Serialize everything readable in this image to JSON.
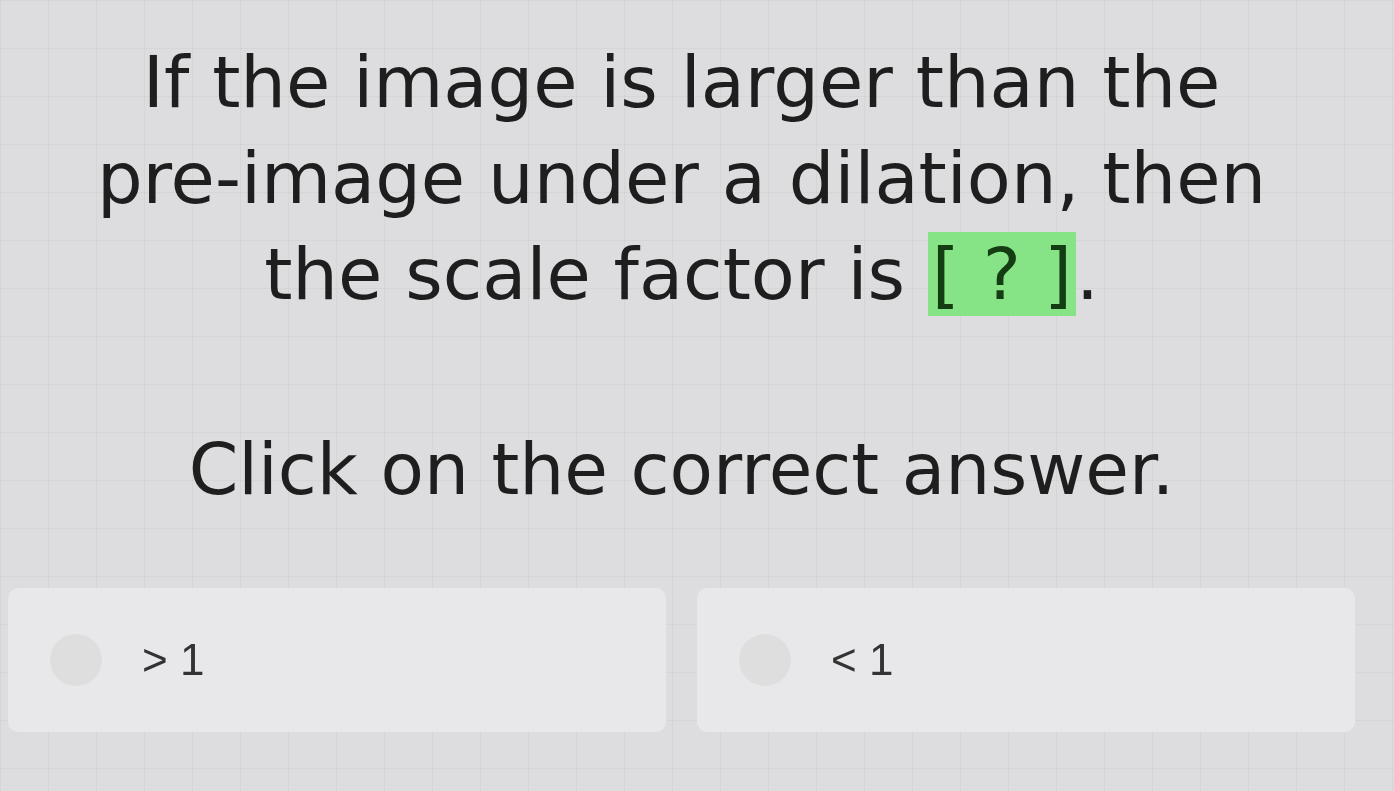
{
  "question": {
    "text": "If the image is larger than the pre-image under a dilation, then the scale factor is",
    "blank": "[ ? ]",
    "end": "."
  },
  "instruction": "Click on the correct answer.",
  "options": [
    {
      "label": "> 1",
      "selected": false
    },
    {
      "label": "< 1",
      "selected": false
    }
  ]
}
